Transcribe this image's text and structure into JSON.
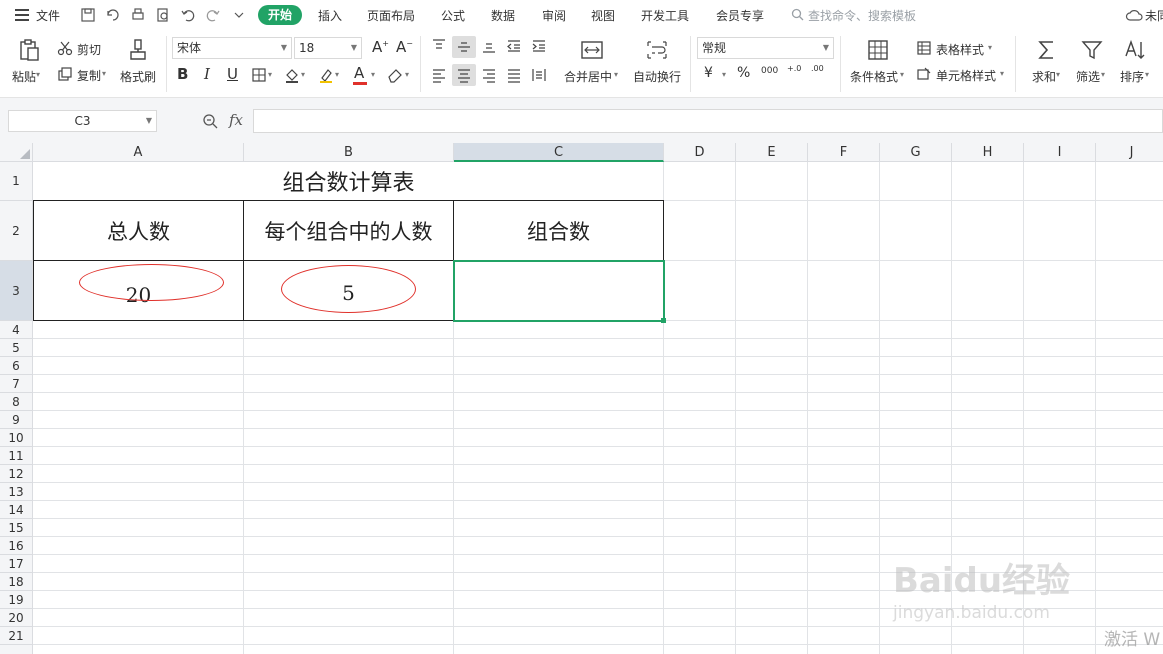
{
  "menubar": {
    "file_label": "文件",
    "tabs": [
      "开始",
      "插入",
      "页面布局",
      "公式",
      "数据",
      "审阅",
      "视图",
      "开发工具",
      "会员专享"
    ],
    "search_placeholder": "查找命令、搜索模板",
    "right_label": "未同"
  },
  "ribbon": {
    "paste": "粘贴",
    "cut": "剪切",
    "copy": "复制",
    "format_painter": "格式刷",
    "font_name": "宋体",
    "font_size": "18",
    "bold": "B",
    "italic": "I",
    "underline": "U",
    "font_color_glyph": "A",
    "merge_center": "合并居中",
    "wrap_text": "自动换行",
    "number_format": "常规",
    "currency": "¥",
    "percent": "%",
    "thousands": "000",
    "inc_decimal": "+.0",
    "dec_decimal": ".00",
    "cond_format": "条件格式",
    "table_style": "表格样式",
    "cell_style": "单元格样式",
    "sum": "求和",
    "filter": "筛选",
    "sort": "排序"
  },
  "formula_bar": {
    "name_box": "C3",
    "fx_label": "fx",
    "content": ""
  },
  "sheet": {
    "columns": [
      "A",
      "B",
      "C",
      "D",
      "E",
      "F",
      "G",
      "H",
      "I",
      "J"
    ],
    "selected_column": "C",
    "rows": [
      "1",
      "2",
      "3",
      "4",
      "5",
      "6",
      "7",
      "8",
      "9",
      "10",
      "11",
      "12",
      "13",
      "14",
      "15",
      "16",
      "17",
      "18",
      "19",
      "20",
      "21"
    ],
    "selected_row": "3",
    "title": "组合数计算表",
    "headers": [
      "总人数",
      "每个组合中的人数",
      "组合数"
    ],
    "values": [
      "20",
      "5",
      ""
    ]
  },
  "watermarks": {
    "baidu_jingyan": "Baidu经验",
    "url": "jingyan.baidu.com",
    "activate": "激活 W"
  },
  "colors": {
    "accent": "#21a366",
    "annotation": "#e0312b"
  }
}
